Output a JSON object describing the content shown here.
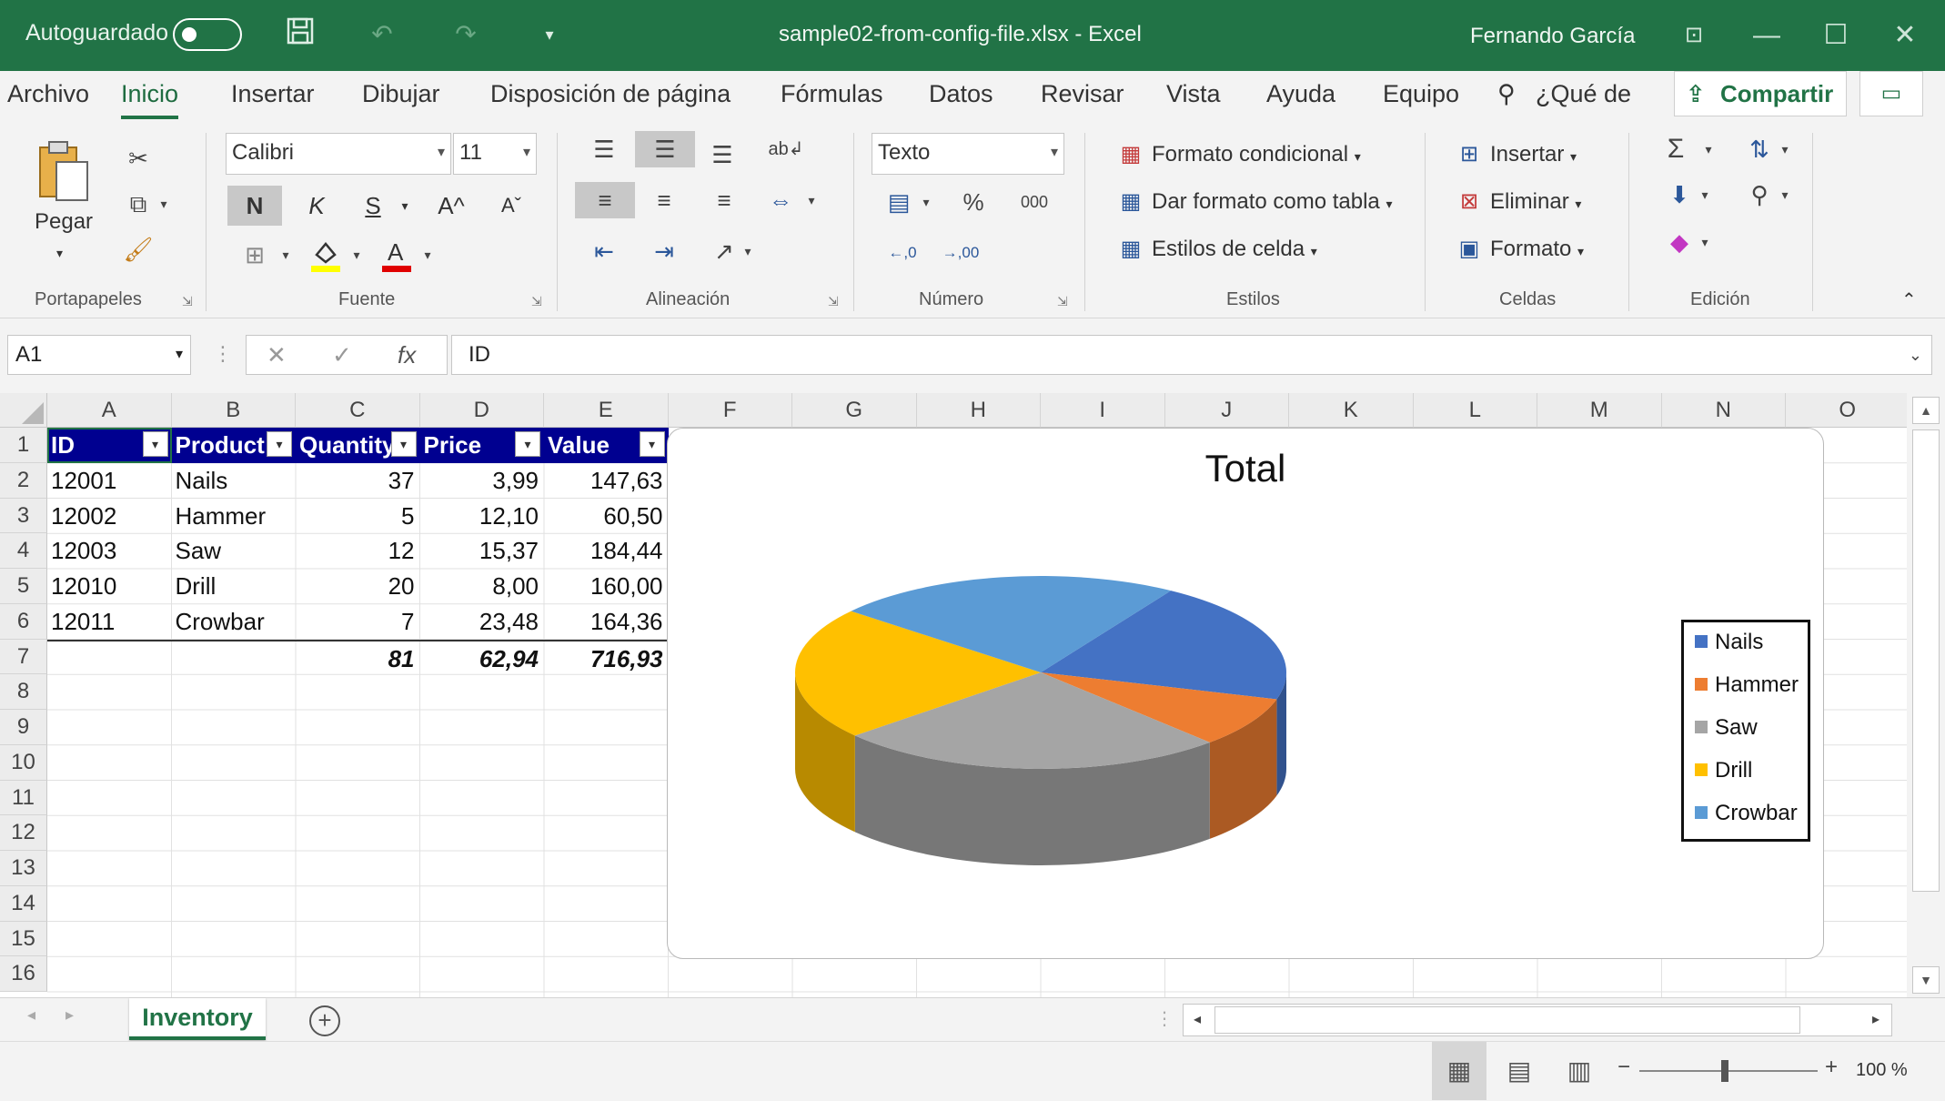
{
  "titlebar": {
    "autosave_label": "Autoguardado",
    "document_title": "sample02-from-config-file.xlsx  -  Excel",
    "user_name": "Fernando García"
  },
  "menu": {
    "tabs": [
      "Archivo",
      "Inicio",
      "Insertar",
      "Dibujar",
      "Disposición de página",
      "Fórmulas",
      "Datos",
      "Revisar",
      "Vista",
      "Ayuda",
      "Equipo"
    ],
    "active_tab": "Inicio",
    "tell_me": "¿Qué de",
    "share_label": "Compartir"
  },
  "ribbon": {
    "clipboard": {
      "paste_label": "Pegar",
      "group_label": "Portapapeles"
    },
    "font": {
      "font_name": "Calibri",
      "font_size": "11",
      "bold_label": "N",
      "italic_label": "K",
      "underline_label": "S",
      "grow_label": "A^",
      "shrink_label": "Aˇ",
      "group_label": "Fuente"
    },
    "alignment": {
      "group_label": "Alineación"
    },
    "number": {
      "format": "Texto",
      "percent_label": "%",
      "thousands_label": "000",
      "group_label": "Número"
    },
    "styles": {
      "conditional_label": "Formato condicional",
      "table_label": "Dar formato como tabla",
      "cell_styles_label": "Estilos de celda",
      "group_label": "Estilos"
    },
    "cells": {
      "insert_label": "Insertar",
      "delete_label": "Eliminar",
      "format_label": "Formato",
      "group_label": "Celdas"
    },
    "editing": {
      "group_label": "Edición"
    }
  },
  "formula_bar": {
    "name_box": "A1",
    "formula": "ID"
  },
  "columns": [
    "A",
    "B",
    "C",
    "D",
    "E",
    "F",
    "G",
    "H",
    "I",
    "J",
    "K",
    "L",
    "M",
    "N",
    "O"
  ],
  "rows": [
    "1",
    "2",
    "3",
    "4",
    "5",
    "6",
    "7",
    "8",
    "9",
    "10",
    "11",
    "12",
    "13",
    "14",
    "15",
    "16"
  ],
  "table": {
    "headers": [
      "ID",
      "Product",
      "Quantity",
      "Price",
      "Value"
    ],
    "rows": [
      [
        "12001",
        "Nails",
        "37",
        "3,99",
        "147,63"
      ],
      [
        "12002",
        "Hammer",
        "5",
        "12,10",
        "60,50"
      ],
      [
        "12003",
        "Saw",
        "12",
        "15,37",
        "184,44"
      ],
      [
        "12010",
        "Drill",
        "20",
        "8,00",
        "160,00"
      ],
      [
        "12011",
        "Crowbar",
        "7",
        "23,48",
        "164,36"
      ]
    ],
    "totals": [
      "81",
      "62,94",
      "716,93"
    ]
  },
  "chart_data": {
    "type": "pie",
    "title": "Total",
    "categories": [
      "Nails",
      "Hammer",
      "Saw",
      "Drill",
      "Crowbar"
    ],
    "values": [
      147.63,
      60.5,
      184.44,
      160.0,
      164.36
    ],
    "colors": [
      "#4472c4",
      "#ed7d31",
      "#a5a5a5",
      "#ffc000",
      "#5b9bd5"
    ],
    "legend_position": "right",
    "style": "3d"
  },
  "sheets": {
    "active": "Inventory"
  },
  "status": {
    "zoom": "100 %"
  },
  "colors": {
    "excel_green": "#217346",
    "table_header": "#000090"
  }
}
